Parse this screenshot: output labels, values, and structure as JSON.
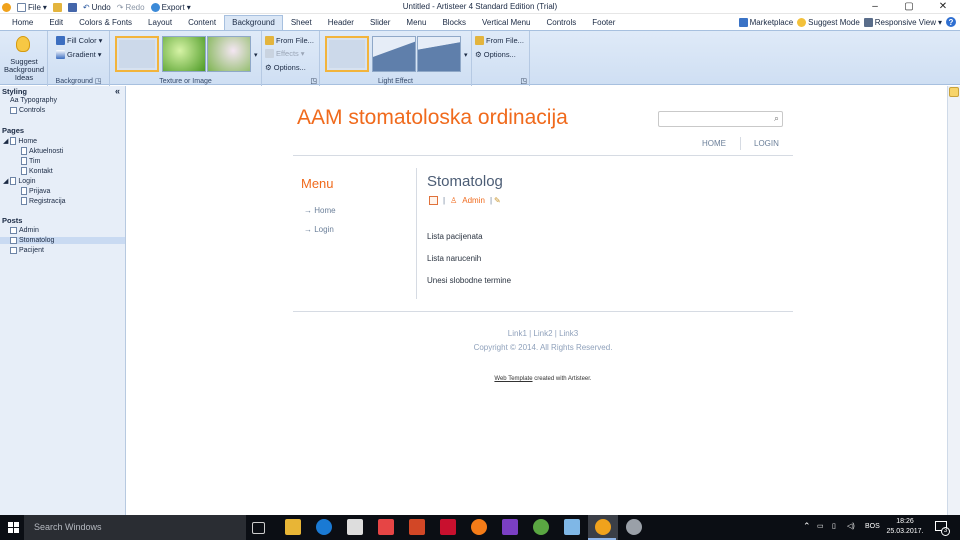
{
  "app": {
    "title": "Untitled - Artisteer 4 Standard Edition (Trial)",
    "quick_access": {
      "file": "File",
      "undo": "Undo",
      "redo": "Redo",
      "export": "Export"
    },
    "window_controls": {
      "minimize": "–",
      "maximize": "▢",
      "close": "✕"
    }
  },
  "tabs": [
    "Home",
    "Edit",
    "Colors & Fonts",
    "Layout",
    "Content",
    "Background",
    "Sheet",
    "Header",
    "Slider",
    "Menu",
    "Blocks",
    "Vertical Menu",
    "Controls",
    "Footer"
  ],
  "active_tab": "Background",
  "right_commands": {
    "marketplace": "Marketplace",
    "suggest_mode": "Suggest Mode",
    "responsive_view": "Responsive View",
    "help": "?"
  },
  "ribbon": {
    "suggest": "Suggest Background Ideas",
    "fill_color": "Fill Color",
    "gradient": "Gradient",
    "group_background": "Background",
    "group_texture": "Texture or Image",
    "group_light": "Light Effect",
    "from_file": "From File...",
    "effects": "Effects",
    "options": "Options..."
  },
  "sidebar": {
    "styling_header": "Styling",
    "styling": [
      "Aa Typography",
      "Controls"
    ],
    "pages_header": "Pages",
    "pages": [
      {
        "label": "Home"
      },
      {
        "label": "Aktuelnosti"
      },
      {
        "label": "Tim"
      },
      {
        "label": "Kontakt"
      },
      {
        "label": "Login"
      },
      {
        "label": "Prijava"
      },
      {
        "label": "Registracija"
      }
    ],
    "posts_header": "Posts",
    "posts": [
      "Admin",
      "Stomatolog",
      "Pacijent"
    ],
    "collapse": "«"
  },
  "site": {
    "title": "AAM stomatoloska ordinacija",
    "nav": [
      "HOME",
      "LOGIN"
    ],
    "menu_title": "Menu",
    "menu_items": [
      "Home",
      "Login"
    ],
    "post_title": "Stomatolog",
    "post_meta_author": "Admin",
    "post_meta_sep": "|",
    "post_lines": [
      "Lista pacijenata",
      "Lista narucenih",
      "Unesi slobodne termine"
    ],
    "footer_links": "Link1 | Link2 | Link3",
    "copyright": "Copyright © 2014. All Rights Reserved.",
    "credit_link": "Web Template",
    "credit_rest": "created with Artisteer."
  },
  "taskbar": {
    "search": "Search Windows",
    "lang": "BOS",
    "time": "18:26",
    "date": "25.03.2017.",
    "badge": "3"
  },
  "colors": {
    "accent": "#f06a1c",
    "ribbon": "#dfeaf8",
    "taskbar": "#0b0e14"
  }
}
